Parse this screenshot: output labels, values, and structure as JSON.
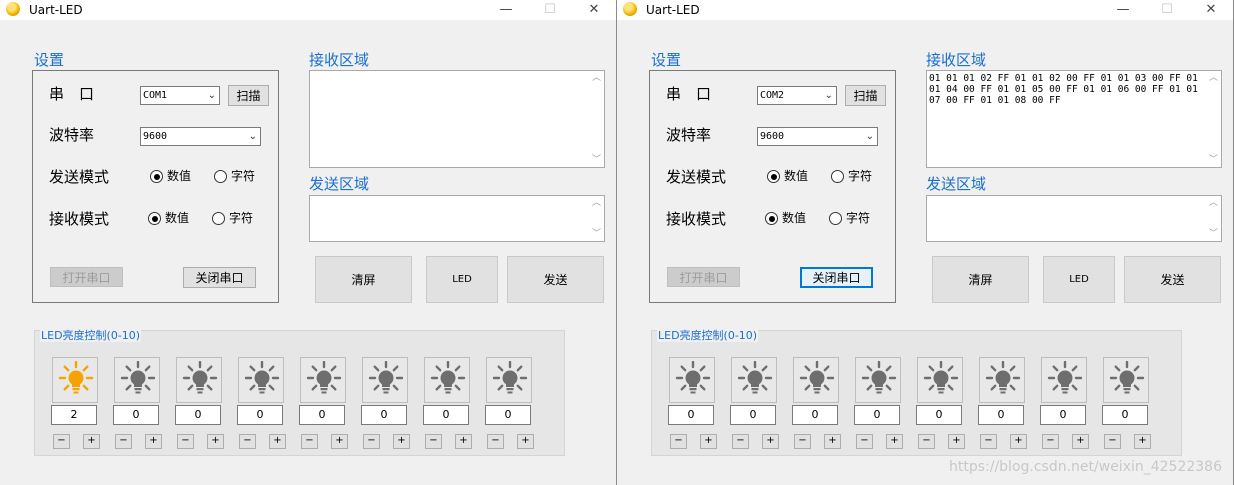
{
  "windows": [
    {
      "title": "Uart-LED",
      "settings_title": "设置",
      "port_label": "串　口",
      "port_value": "COM1",
      "scan_label": "扫描",
      "baud_label": "波特率",
      "baud_value": "9600",
      "send_mode_label": "发送模式",
      "recv_mode_label": "接收模式",
      "numeric_label": "数值",
      "char_label": "字符",
      "open_label": "打开串口",
      "close_label": "关闭串口",
      "recv_title": "接收区域",
      "recv_text": "",
      "send_title": "发送区域",
      "send_text": "",
      "clear_label": "清屏",
      "led_label": "LED",
      "send_label": "发送",
      "led_group_title": "LED亮度控制(0-10)",
      "led_values": [
        "2",
        "0",
        "0",
        "0",
        "0",
        "0",
        "0",
        "0"
      ],
      "led_on": [
        true,
        false,
        false,
        false,
        false,
        false,
        false,
        false
      ],
      "minus": "−",
      "plus": "+"
    },
    {
      "title": "Uart-LED",
      "settings_title": "设置",
      "port_label": "串　口",
      "port_value": "COM2",
      "scan_label": "扫描",
      "baud_label": "波特率",
      "baud_value": "9600",
      "send_mode_label": "发送模式",
      "recv_mode_label": "接收模式",
      "numeric_label": "数值",
      "char_label": "字符",
      "open_label": "打开串口",
      "close_label": "关闭串口",
      "recv_title": "接收区域",
      "recv_text": "01 01 01 02 FF 01 01 02 00 FF 01 01 03 00 FF 01 01 04 00 FF 01 01 05 00 FF 01 01 06 00 FF 01 01 07 00 FF 01 01 08 00 FF",
      "send_title": "发送区域",
      "send_text": "",
      "clear_label": "清屏",
      "led_label": "LED",
      "send_label": "发送",
      "led_group_title": "LED亮度控制(0-10)",
      "led_values": [
        "0",
        "0",
        "0",
        "0",
        "0",
        "0",
        "0",
        "0"
      ],
      "led_on": [
        false,
        false,
        false,
        false,
        false,
        false,
        false,
        false
      ],
      "minus": "−",
      "plus": "+"
    }
  ],
  "titlebar_buttons": {
    "minimize": "—",
    "maximize": "☐",
    "close": "✕"
  },
  "watermark": "https://blog.csdn.net/weixin_42522386",
  "colors": {
    "accent_blue": "#1a6fcf",
    "bulb_on": "#f5a300",
    "bulb_off": "#6e6e6e"
  }
}
